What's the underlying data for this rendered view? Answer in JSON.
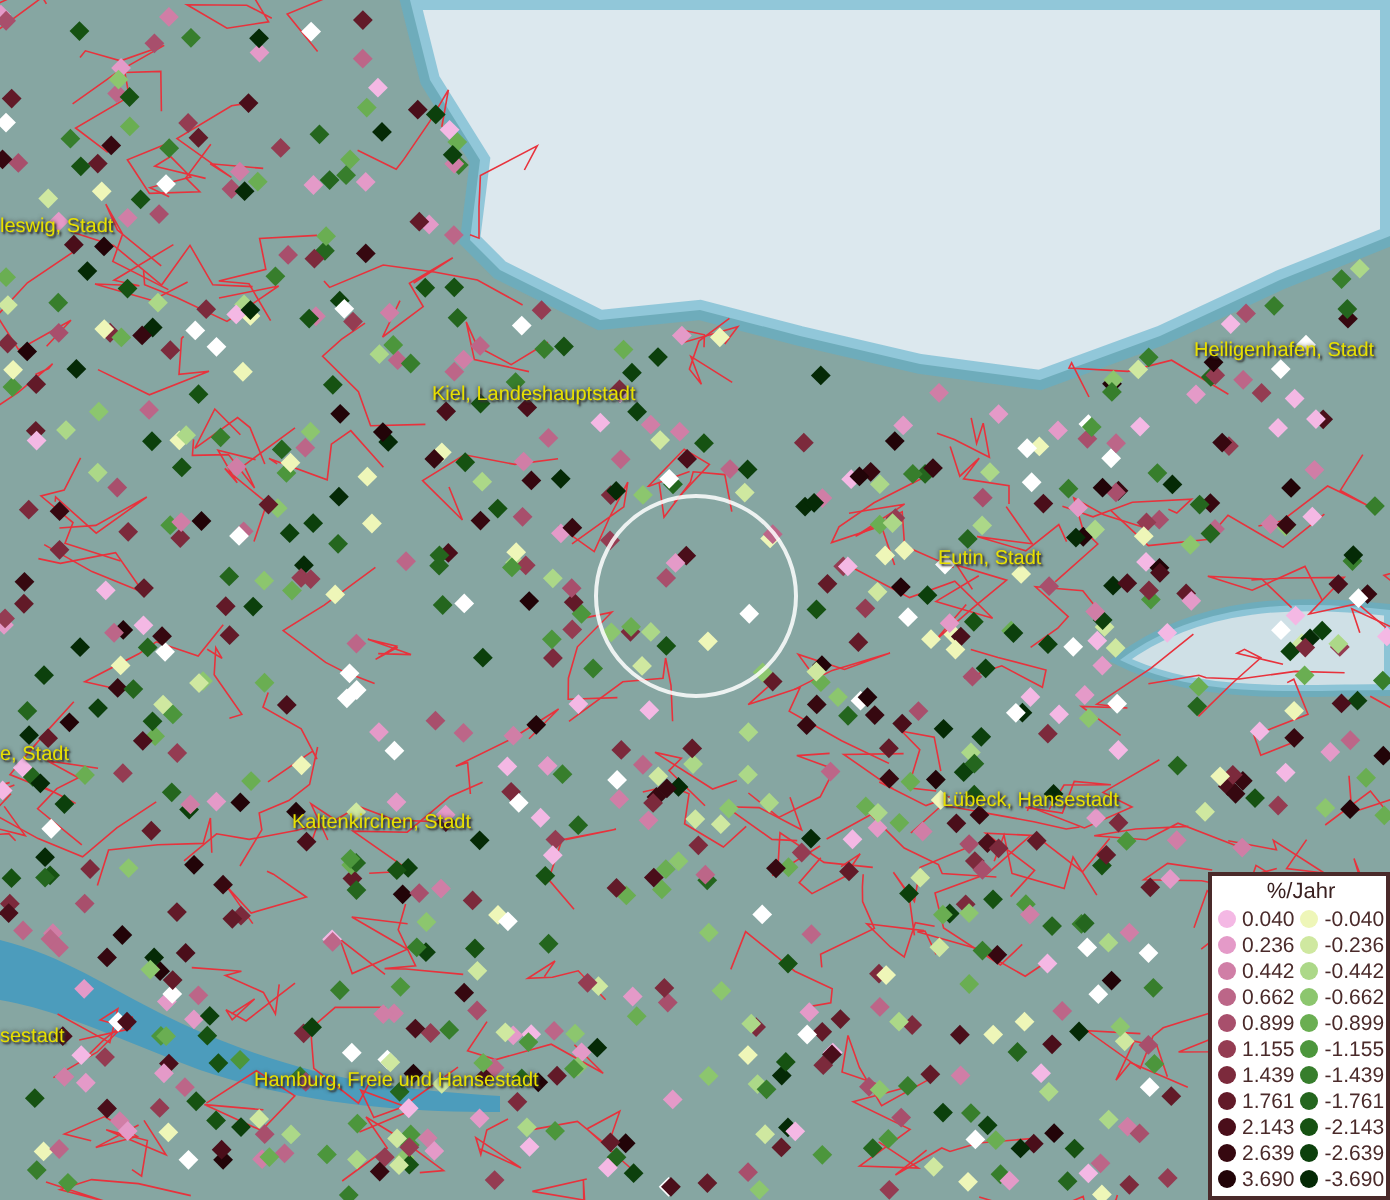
{
  "map": {
    "places": [
      {
        "name": "leswig, Stadt"
      },
      {
        "name": "Kiel, Landeshauptstadt"
      },
      {
        "name": "Heiligenhafen, Stadt"
      },
      {
        "name": "Eutin, Stadt"
      },
      {
        "name": "e, Stadt"
      },
      {
        "name": "Kaltenkirchen, Stadt"
      },
      {
        "name": "Lübeck, Hansestadt"
      },
      {
        "name": "sestadt"
      },
      {
        "name": "Hamburg, Freie und Hansestadt"
      }
    ]
  },
  "legend": {
    "title": "%/Jahr",
    "columns": [
      [
        {
          "value": "0.040",
          "color": "#f4b8e4"
        },
        {
          "value": "0.236",
          "color": "#e49ac8"
        },
        {
          "value": "0.442",
          "color": "#d07ea6"
        },
        {
          "value": "0.662",
          "color": "#bc6688"
        },
        {
          "value": "0.899",
          "color": "#a84f6c"
        },
        {
          "value": "1.155",
          "color": "#943c52"
        },
        {
          "value": "1.439",
          "color": "#7c2a3c"
        },
        {
          "value": "1.761",
          "color": "#621a28"
        },
        {
          "value": "2.143",
          "color": "#4a0e1a"
        },
        {
          "value": "2.639",
          "color": "#360810"
        },
        {
          "value": "3.690",
          "color": "#220408"
        }
      ],
      [
        {
          "value": "-0.040",
          "color": "#eef6b8"
        },
        {
          "value": "-0.236",
          "color": "#cfe8a0"
        },
        {
          "value": "-0.442",
          "color": "#acd888"
        },
        {
          "value": "-0.662",
          "color": "#8cc66e"
        },
        {
          "value": "-0.899",
          "color": "#6aae52"
        },
        {
          "value": "-1.155",
          "color": "#4c963c"
        },
        {
          "value": "-1.439",
          "color": "#377e2c"
        },
        {
          "value": "-1.761",
          "color": "#24661e"
        },
        {
          "value": "-2.143",
          "color": "#165212"
        },
        {
          "value": "-2.639",
          "color": "#0c400c"
        },
        {
          "value": "-3.690",
          "color": "#052a06"
        }
      ]
    ]
  }
}
